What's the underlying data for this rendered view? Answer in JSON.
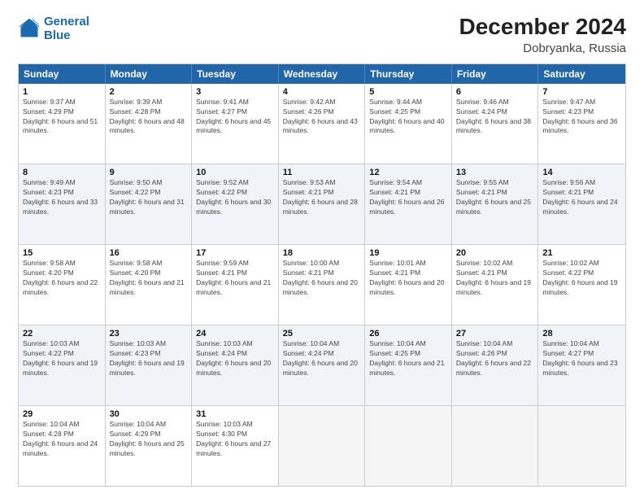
{
  "logo": {
    "line1": "General",
    "line2": "Blue"
  },
  "title": "December 2024",
  "subtitle": "Dobryanka, Russia",
  "days": [
    "Sunday",
    "Monday",
    "Tuesday",
    "Wednesday",
    "Thursday",
    "Friday",
    "Saturday"
  ],
  "rows": [
    [
      {
        "num": "1",
        "rise": "9:37 AM",
        "set": "4:29 PM",
        "daylight": "6 hours and 51 minutes."
      },
      {
        "num": "2",
        "rise": "9:39 AM",
        "set": "4:28 PM",
        "daylight": "6 hours and 48 minutes."
      },
      {
        "num": "3",
        "rise": "9:41 AM",
        "set": "4:27 PM",
        "daylight": "6 hours and 45 minutes."
      },
      {
        "num": "4",
        "rise": "9:42 AM",
        "set": "4:26 PM",
        "daylight": "6 hours and 43 minutes."
      },
      {
        "num": "5",
        "rise": "9:44 AM",
        "set": "4:25 PM",
        "daylight": "6 hours and 40 minutes."
      },
      {
        "num": "6",
        "rise": "9:46 AM",
        "set": "4:24 PM",
        "daylight": "6 hours and 38 minutes."
      },
      {
        "num": "7",
        "rise": "9:47 AM",
        "set": "4:23 PM",
        "daylight": "6 hours and 36 minutes."
      }
    ],
    [
      {
        "num": "8",
        "rise": "9:49 AM",
        "set": "4:23 PM",
        "daylight": "6 hours and 33 minutes."
      },
      {
        "num": "9",
        "rise": "9:50 AM",
        "set": "4:22 PM",
        "daylight": "6 hours and 31 minutes."
      },
      {
        "num": "10",
        "rise": "9:52 AM",
        "set": "4:22 PM",
        "daylight": "6 hours and 30 minutes."
      },
      {
        "num": "11",
        "rise": "9:53 AM",
        "set": "4:21 PM",
        "daylight": "6 hours and 28 minutes."
      },
      {
        "num": "12",
        "rise": "9:54 AM",
        "set": "4:21 PM",
        "daylight": "6 hours and 26 minutes."
      },
      {
        "num": "13",
        "rise": "9:55 AM",
        "set": "4:21 PM",
        "daylight": "6 hours and 25 minutes."
      },
      {
        "num": "14",
        "rise": "9:56 AM",
        "set": "4:21 PM",
        "daylight": "6 hours and 24 minutes."
      }
    ],
    [
      {
        "num": "15",
        "rise": "9:58 AM",
        "set": "4:20 PM",
        "daylight": "6 hours and 22 minutes."
      },
      {
        "num": "16",
        "rise": "9:58 AM",
        "set": "4:20 PM",
        "daylight": "6 hours and 21 minutes."
      },
      {
        "num": "17",
        "rise": "9:59 AM",
        "set": "4:21 PM",
        "daylight": "6 hours and 21 minutes."
      },
      {
        "num": "18",
        "rise": "10:00 AM",
        "set": "4:21 PM",
        "daylight": "6 hours and 20 minutes."
      },
      {
        "num": "19",
        "rise": "10:01 AM",
        "set": "4:21 PM",
        "daylight": "6 hours and 20 minutes."
      },
      {
        "num": "20",
        "rise": "10:02 AM",
        "set": "4:21 PM",
        "daylight": "6 hours and 19 minutes."
      },
      {
        "num": "21",
        "rise": "10:02 AM",
        "set": "4:22 PM",
        "daylight": "6 hours and 19 minutes."
      }
    ],
    [
      {
        "num": "22",
        "rise": "10:03 AM",
        "set": "4:22 PM",
        "daylight": "6 hours and 19 minutes."
      },
      {
        "num": "23",
        "rise": "10:03 AM",
        "set": "4:23 PM",
        "daylight": "6 hours and 19 minutes."
      },
      {
        "num": "24",
        "rise": "10:03 AM",
        "set": "4:24 PM",
        "daylight": "6 hours and 20 minutes."
      },
      {
        "num": "25",
        "rise": "10:04 AM",
        "set": "4:24 PM",
        "daylight": "6 hours and 20 minutes."
      },
      {
        "num": "26",
        "rise": "10:04 AM",
        "set": "4:25 PM",
        "daylight": "6 hours and 21 minutes."
      },
      {
        "num": "27",
        "rise": "10:04 AM",
        "set": "4:26 PM",
        "daylight": "6 hours and 22 minutes."
      },
      {
        "num": "28",
        "rise": "10:04 AM",
        "set": "4:27 PM",
        "daylight": "6 hours and 23 minutes."
      }
    ],
    [
      {
        "num": "29",
        "rise": "10:04 AM",
        "set": "4:28 PM",
        "daylight": "6 hours and 24 minutes."
      },
      {
        "num": "30",
        "rise": "10:04 AM",
        "set": "4:29 PM",
        "daylight": "6 hours and 25 minutes."
      },
      {
        "num": "31",
        "rise": "10:03 AM",
        "set": "4:30 PM",
        "daylight": "6 hours and 27 minutes."
      },
      null,
      null,
      null,
      null
    ]
  ]
}
